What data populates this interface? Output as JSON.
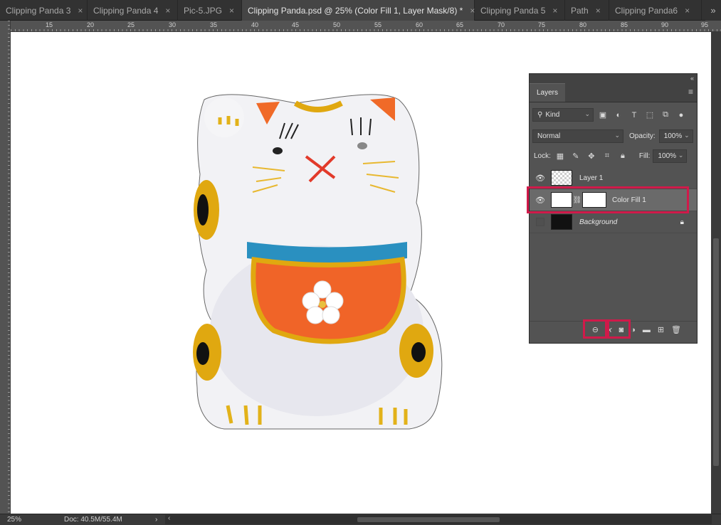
{
  "tabs": [
    {
      "label": "Clipping Panda 3",
      "close": "×"
    },
    {
      "label": "Clipping Panda 4",
      "close": "×"
    },
    {
      "label": "Pic-5.JPG",
      "close": "×"
    },
    {
      "label": "Clipping Panda.psd @ 25% (Color Fill 1, Layer Mask/8) *",
      "close": "×"
    },
    {
      "label": "Clipping Panda 5",
      "close": "×"
    },
    {
      "label": "Path",
      "close": "×"
    },
    {
      "label": "Clipping Panda6",
      "close": "×"
    }
  ],
  "overflow": "»",
  "ruler": {
    "top": [
      "15",
      "20",
      "25",
      "30",
      "35",
      "40",
      "45",
      "50",
      "55",
      "60",
      "65",
      "70",
      "75",
      "80",
      "85",
      "90",
      "95"
    ]
  },
  "status": {
    "zoom": "25%",
    "doc": "Doc: 40.5M/55.4M",
    "arrow": "›",
    "scroll_left": "‹"
  },
  "layers_panel": {
    "collapse": "«",
    "tab": "Layers",
    "menu": "≡",
    "filter_kind": "Kind",
    "blend_mode": "Normal",
    "opacity_label": "Opacity:",
    "opacity_value": "100%",
    "lock_label": "Lock:",
    "fill_label": "Fill:",
    "fill_value": "100%",
    "layers": [
      {
        "name": "Layer 1",
        "visible": true
      },
      {
        "name": "Color Fill 1",
        "visible": true,
        "selected": true
      },
      {
        "name": "Background",
        "visible": false,
        "locked": true
      }
    ],
    "footer_icons": [
      "link-icon",
      "fx-icon",
      "mask-icon",
      "adjustment-icon",
      "group-icon",
      "new-layer-icon",
      "trash-icon"
    ]
  },
  "colors": {
    "highlight": "#d01a4a",
    "panel": "#535353"
  }
}
